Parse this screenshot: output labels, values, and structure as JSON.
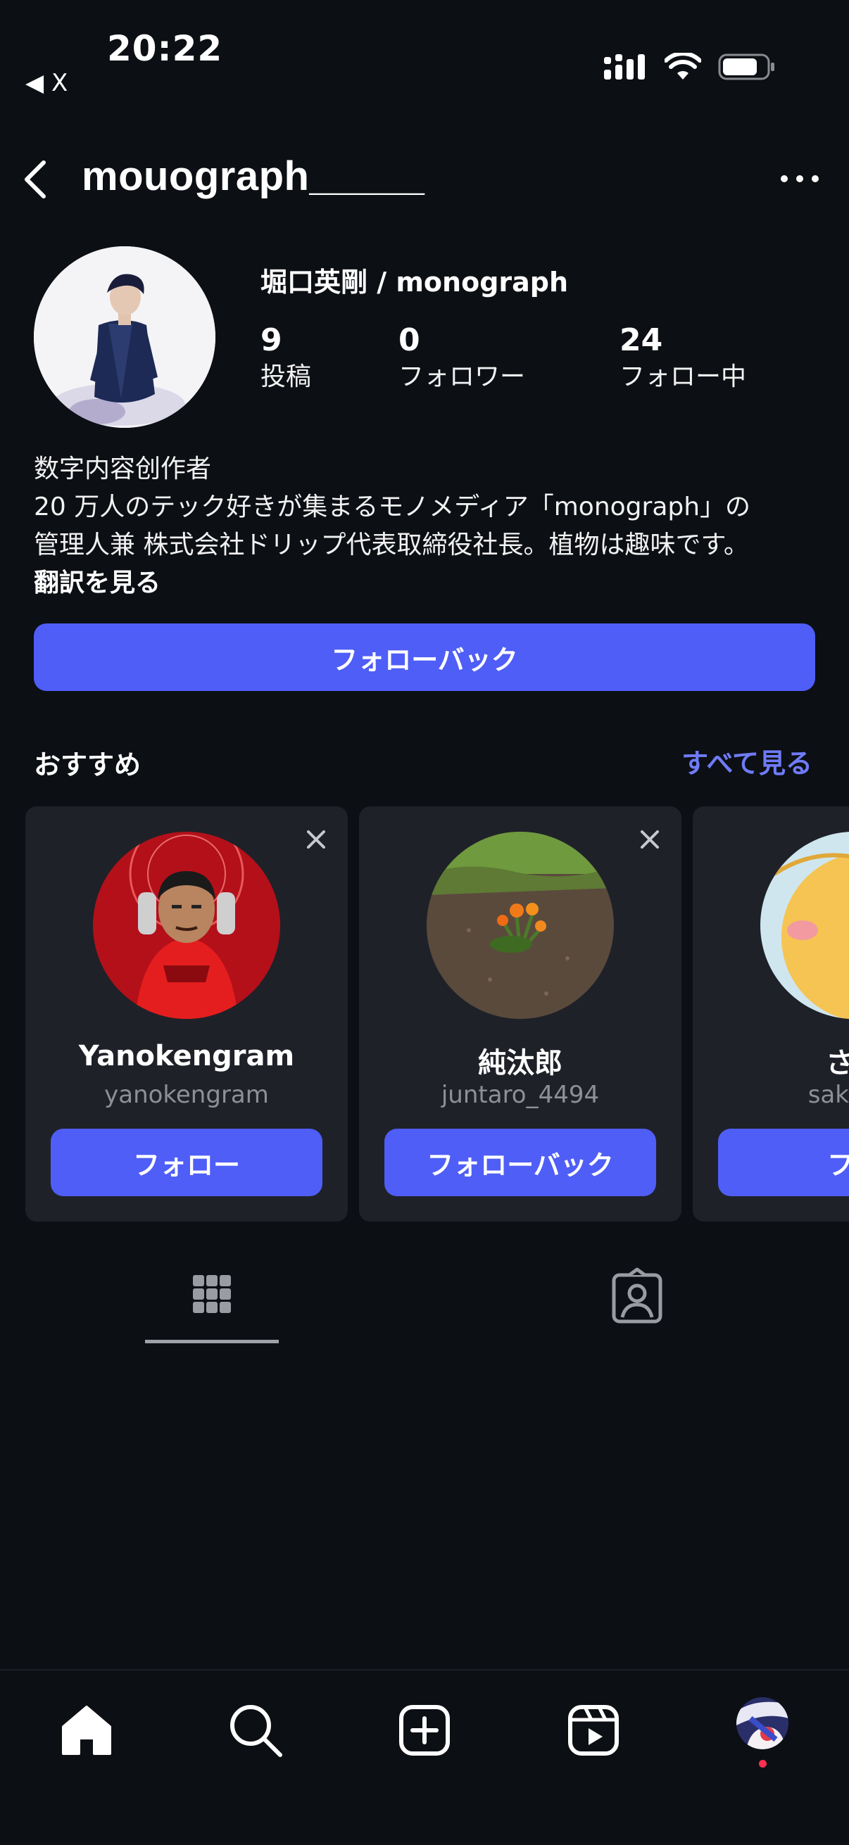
{
  "status_bar": {
    "time": "20:22",
    "back_app": "◀ X"
  },
  "header": {
    "username": "mouograph_____"
  },
  "profile": {
    "full_name": "堀口英剛 / monograph",
    "stats": [
      {
        "value": "9",
        "label": "投稿"
      },
      {
        "value": "0",
        "label": "フォロワー"
      },
      {
        "value": "24",
        "label": "フォロー中"
      }
    ],
    "bio_lines": [
      "数字内容创作者",
      "20 万人のテック好きが集まるモノメディア「monograph」の",
      "管理人兼 株式会社ドリップ代表取締役社長。植物は趣味です。"
    ],
    "translate_label": "翻訳を見る",
    "follow_back_label": "フォローバック"
  },
  "suggestions": {
    "title": "おすすめ",
    "see_all": "すべて見る",
    "cards": [
      {
        "name": "Yanokengram",
        "handle": "yanokengram",
        "button": "フォロー"
      },
      {
        "name": "純汰郎",
        "handle": "juntaro_4494",
        "button": "フォローバック"
      },
      {
        "name": "さく",
        "handle": "sakura_",
        "button": "フォ"
      }
    ]
  },
  "tabs": [
    "grid-icon",
    "tagged-icon"
  ],
  "bottom_nav": [
    "home-icon",
    "search-icon",
    "create-icon",
    "reels-icon",
    "profile-avatar"
  ],
  "colors": {
    "background": "#0c0f14",
    "accent": "#4f5ef6",
    "link": "#6f7bf7",
    "card": "#1f2128",
    "notification_dot": "#ff2f4f"
  }
}
